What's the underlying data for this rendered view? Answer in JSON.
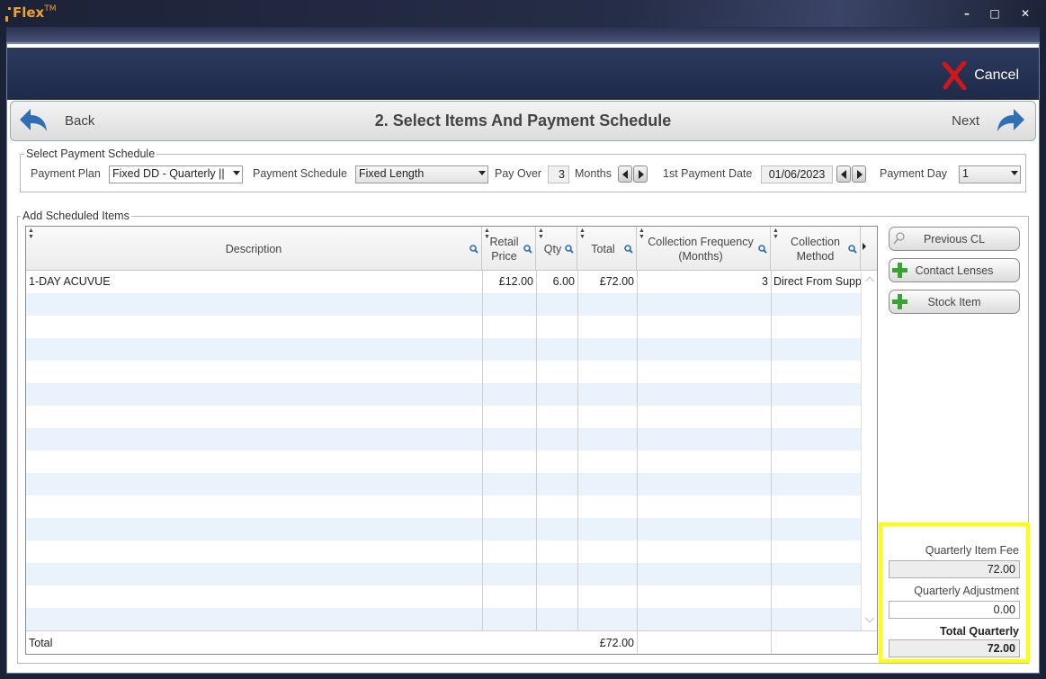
{
  "app": {
    "name": "Flex",
    "trademark": "TM"
  },
  "window": {
    "minimize": "–",
    "maximize": "□",
    "close": "✕"
  },
  "header": {
    "cancel_label": "Cancel"
  },
  "nav": {
    "back_label": "Back",
    "title": "2. Select Items And Payment Schedule",
    "next_label": "Next"
  },
  "payment_schedule": {
    "legend": "Select Payment Schedule",
    "plan_label": "Payment Plan",
    "plan_value": "Fixed DD - Quarterly ||",
    "schedule_label": "Payment Schedule",
    "schedule_value": "Fixed Length",
    "pay_over_label": "Pay Over",
    "pay_over_value": "3",
    "months_label": "Months",
    "first_date_label": "1st Payment Date",
    "first_date_value": "01/06/2023",
    "payment_day_label": "Payment Day",
    "payment_day_value": "1"
  },
  "items": {
    "legend": "Add Scheduled Items",
    "columns": [
      "Description",
      "Retail Price",
      "Qty",
      "Total",
      "Collection Frequency (Months)",
      "Collection Method"
    ],
    "rows": [
      {
        "description": "1-DAY ACUVUE",
        "retail_price": "£12.00",
        "qty": "6.00",
        "total": "£72.00",
        "frequency": "3",
        "method": "Direct From Supp"
      }
    ],
    "total_label": "Total",
    "total_value": "£72.00"
  },
  "side_buttons": {
    "previous_cl": "Previous CL",
    "contact_lenses": "Contact Lenses",
    "stock_item": "Stock Item"
  },
  "summary": {
    "item_fee_label": "Quarterly Item Fee",
    "item_fee_value": "72.00",
    "adjustment_label": "Quarterly Adjustment",
    "adjustment_value": "0.00",
    "total_label": "Total Quarterly",
    "total_value": "72.00",
    "highlight_color": "#ffff00"
  },
  "colors": {
    "accent_blue": "#2f6fb5",
    "cancel_red": "#d01818",
    "add_green": "#3aa338",
    "row_alt": "#eaf2fb"
  }
}
